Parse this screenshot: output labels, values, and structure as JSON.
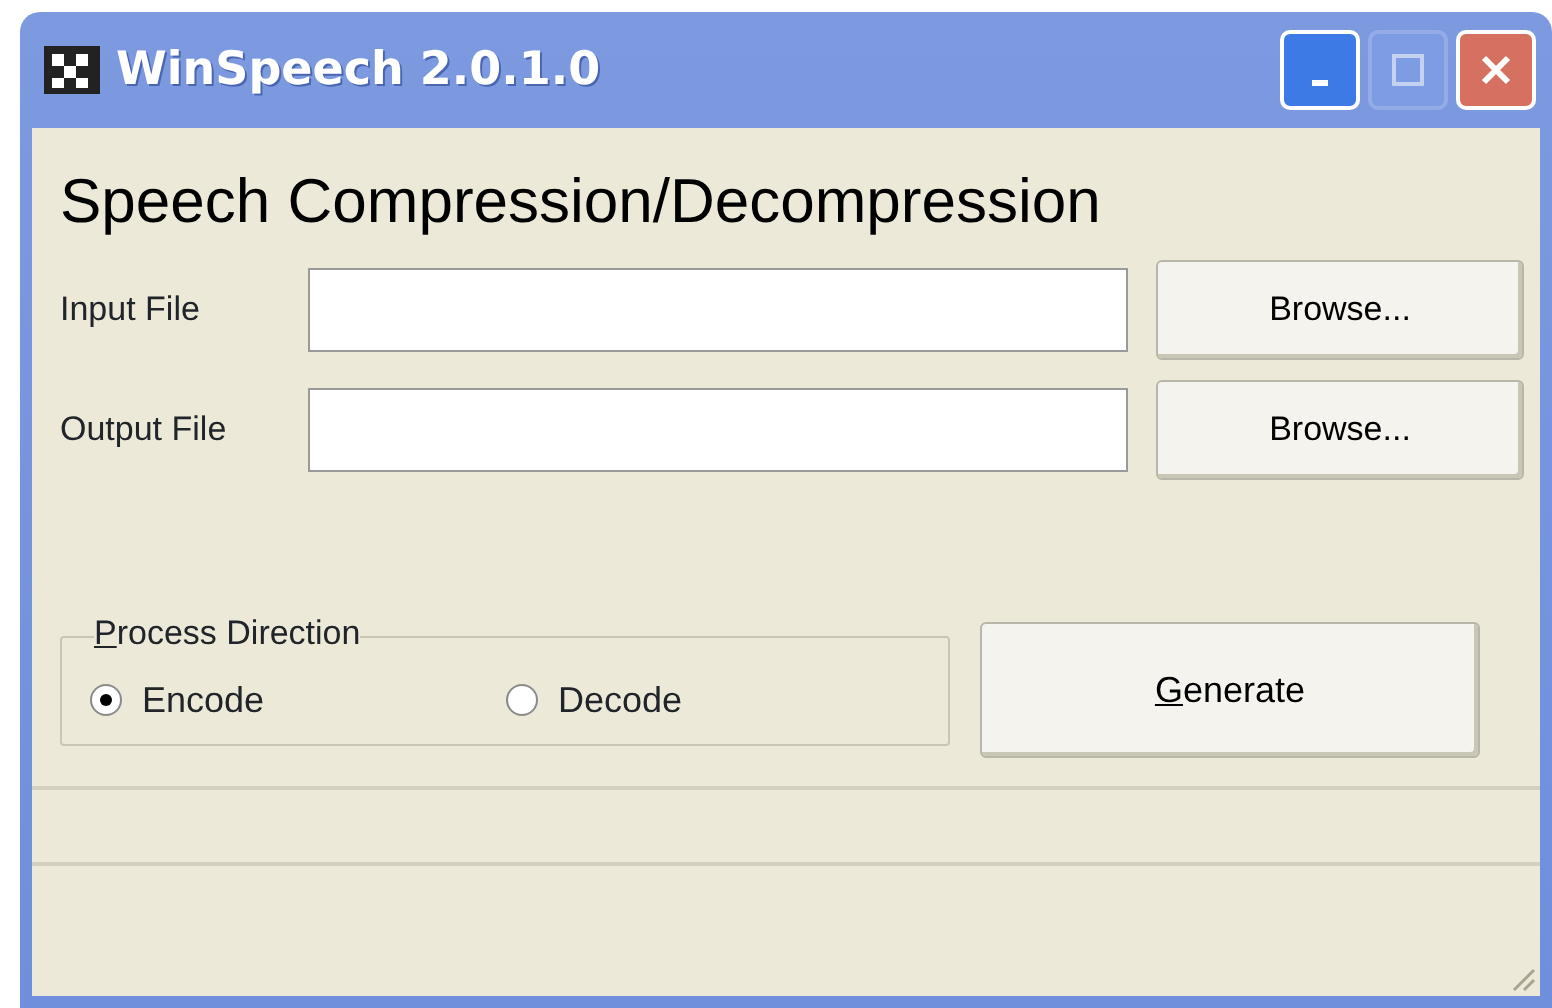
{
  "window": {
    "title": "WinSpeech 2.0.1.0",
    "controls": [
      {
        "kind": "minimize",
        "disabled": false
      },
      {
        "kind": "maximize",
        "disabled": true
      },
      {
        "kind": "close",
        "disabled": false
      }
    ]
  },
  "heading": "Speech Compression/Decompression",
  "fields": [
    {
      "label": "Input File",
      "button": "Browse..."
    },
    {
      "label": "Output File",
      "button": "Browse..."
    }
  ],
  "process_direction": {
    "title": "Process Direction",
    "underline_first": true,
    "options": [
      {
        "label": "Encode",
        "selected": true
      },
      {
        "label": "Decode",
        "selected": false
      }
    ]
  },
  "generate_button": {
    "label": "Generate",
    "underline_first": true
  }
}
